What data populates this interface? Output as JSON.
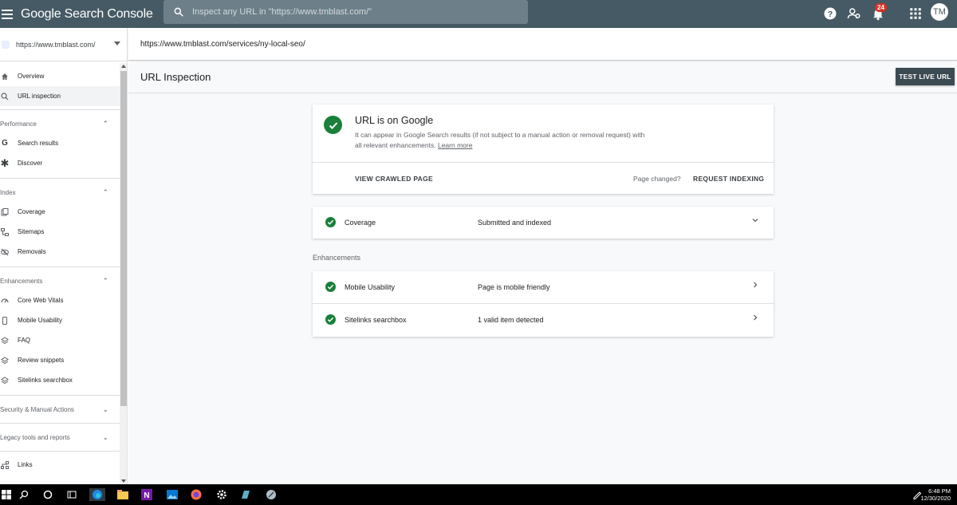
{
  "topbar": {
    "app_title": "Google Search Console",
    "search_placeholder": "Inspect any URL in \"https://www.tmblast.com/\"",
    "notification_count": "24",
    "avatar_initials": "TM"
  },
  "sidebar": {
    "property": "https://www.tmblast.com/",
    "top_items": [
      {
        "label": "Overview",
        "icon": "home-icon"
      },
      {
        "label": "URL inspection",
        "icon": "search-icon",
        "active": true
      }
    ],
    "sections": [
      {
        "title": "Performance",
        "items": [
          {
            "label": "Search results",
            "icon": "google-g-icon"
          },
          {
            "label": "Discover",
            "icon": "asterisk-icon"
          }
        ]
      },
      {
        "title": "Index",
        "items": [
          {
            "label": "Coverage",
            "icon": "pages-icon"
          },
          {
            "label": "Sitemaps",
            "icon": "sitemap-icon"
          },
          {
            "label": "Removals",
            "icon": "eye-off-icon"
          }
        ]
      },
      {
        "title": "Enhancements",
        "items": [
          {
            "label": "Core Web Vitals",
            "icon": "gauge-icon"
          },
          {
            "label": "Mobile Usability",
            "icon": "phone-icon"
          },
          {
            "label": "FAQ",
            "icon": "layers-icon"
          },
          {
            "label": "Review snippets",
            "icon": "layers-icon"
          },
          {
            "label": "Sitelinks searchbox",
            "icon": "layers-icon"
          }
        ]
      },
      {
        "title": "Security & Manual Actions"
      },
      {
        "title": "Legacy tools and reports"
      }
    ],
    "bottom_items": [
      {
        "label": "Links",
        "icon": "links-icon"
      }
    ]
  },
  "main": {
    "inspected_url": "https://www.tmblast.com/services/ny-local-seo/",
    "page_title": "URL Inspection",
    "test_live_button": "TEST LIVE URL",
    "status": {
      "title": "URL is on Google",
      "description": "It can appear in Google Search results (if not subject to a manual action or removal request) with all relevant enhancements.",
      "learn_more": "Learn more",
      "view_crawled": "VIEW CRAWLED PAGE",
      "page_changed": "Page changed?",
      "request_indexing": "REQUEST INDEXING"
    },
    "coverage": {
      "label": "Coverage",
      "value": "Submitted and indexed"
    },
    "enhancements_label": "Enhancements",
    "enhancements": [
      {
        "label": "Mobile Usability",
        "value": "Page is mobile friendly"
      },
      {
        "label": "Sitelinks searchbox",
        "value": "1 valid item detected"
      }
    ]
  },
  "taskbar": {
    "time": "6:48 PM",
    "date": "12/30/2020"
  },
  "colors": {
    "topbar": "#455a64",
    "success_green": "#188038",
    "button_dark": "#3c4a52"
  }
}
